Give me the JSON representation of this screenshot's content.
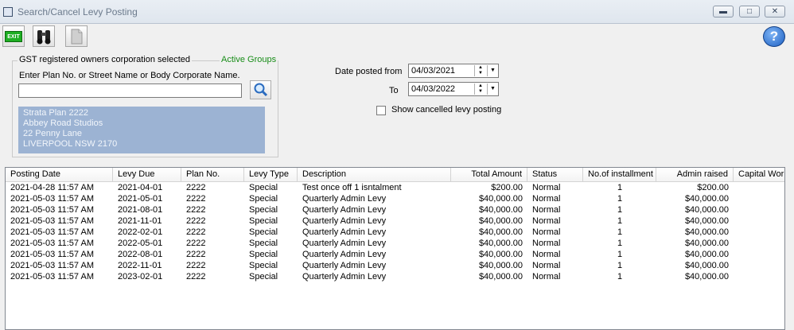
{
  "window": {
    "title": "Search/Cancel Levy Posting"
  },
  "toolbar": {
    "exit_label": "EXIT"
  },
  "groupbox": {
    "label": "GST registered owners corporation selected",
    "active_groups": "Active Groups",
    "enter_label": "Enter Plan No. or Street Name or Body Corporate Name.",
    "search_value": "",
    "address": [
      "Strata Plan 2222",
      "Abbey Road Studios",
      "22 Penny Lane",
      "LIVERPOOL  NSW  2170"
    ]
  },
  "dates": {
    "from_label": "Date posted from",
    "from_value": "04/03/2021",
    "to_label": "To",
    "to_value": "04/03/2022"
  },
  "show_cancelled": {
    "label": "Show cancelled levy posting",
    "checked": false
  },
  "table": {
    "headers": [
      "Posting Date",
      "Levy Due",
      "Plan No.",
      "Levy Type",
      "Description",
      "Total Amount",
      "Status",
      "No.of installment",
      "Admin raised",
      "Capital Wor"
    ],
    "rows": [
      [
        "2021-04-28  11:57 AM",
        "2021-04-01",
        "2222",
        "Special",
        "Test once off 1 isntalment",
        "$200.00",
        "Normal",
        "1",
        "$200.00"
      ],
      [
        "2021-05-03  11:57 AM",
        "2021-05-01",
        "2222",
        "Special",
        "Quarterly Admin Levy",
        "$40,000.00",
        "Normal",
        "1",
        "$40,000.00"
      ],
      [
        "2021-05-03  11:57 AM",
        "2021-08-01",
        "2222",
        "Special",
        "Quarterly Admin Levy",
        "$40,000.00",
        "Normal",
        "1",
        "$40,000.00"
      ],
      [
        "2021-05-03  11:57 AM",
        "2021-11-01",
        "2222",
        "Special",
        "Quarterly Admin Levy",
        "$40,000.00",
        "Normal",
        "1",
        "$40,000.00"
      ],
      [
        "2021-05-03  11:57 AM",
        "2022-02-01",
        "2222",
        "Special",
        "Quarterly Admin Levy",
        "$40,000.00",
        "Normal",
        "1",
        "$40,000.00"
      ],
      [
        "2021-05-03  11:57 AM",
        "2022-05-01",
        "2222",
        "Special",
        "Quarterly Admin Levy",
        "$40,000.00",
        "Normal",
        "1",
        "$40,000.00"
      ],
      [
        "2021-05-03  11:57 AM",
        "2022-08-01",
        "2222",
        "Special",
        "Quarterly Admin Levy",
        "$40,000.00",
        "Normal",
        "1",
        "$40,000.00"
      ],
      [
        "2021-05-03  11:57 AM",
        "2022-11-01",
        "2222",
        "Special",
        "Quarterly Admin Levy",
        "$40,000.00",
        "Normal",
        "1",
        "$40,000.00"
      ],
      [
        "2021-05-03  11:57 AM",
        "2023-02-01",
        "2222",
        "Special",
        "Quarterly Admin Levy",
        "$40,000.00",
        "Normal",
        "1",
        "$40,000.00"
      ]
    ]
  }
}
